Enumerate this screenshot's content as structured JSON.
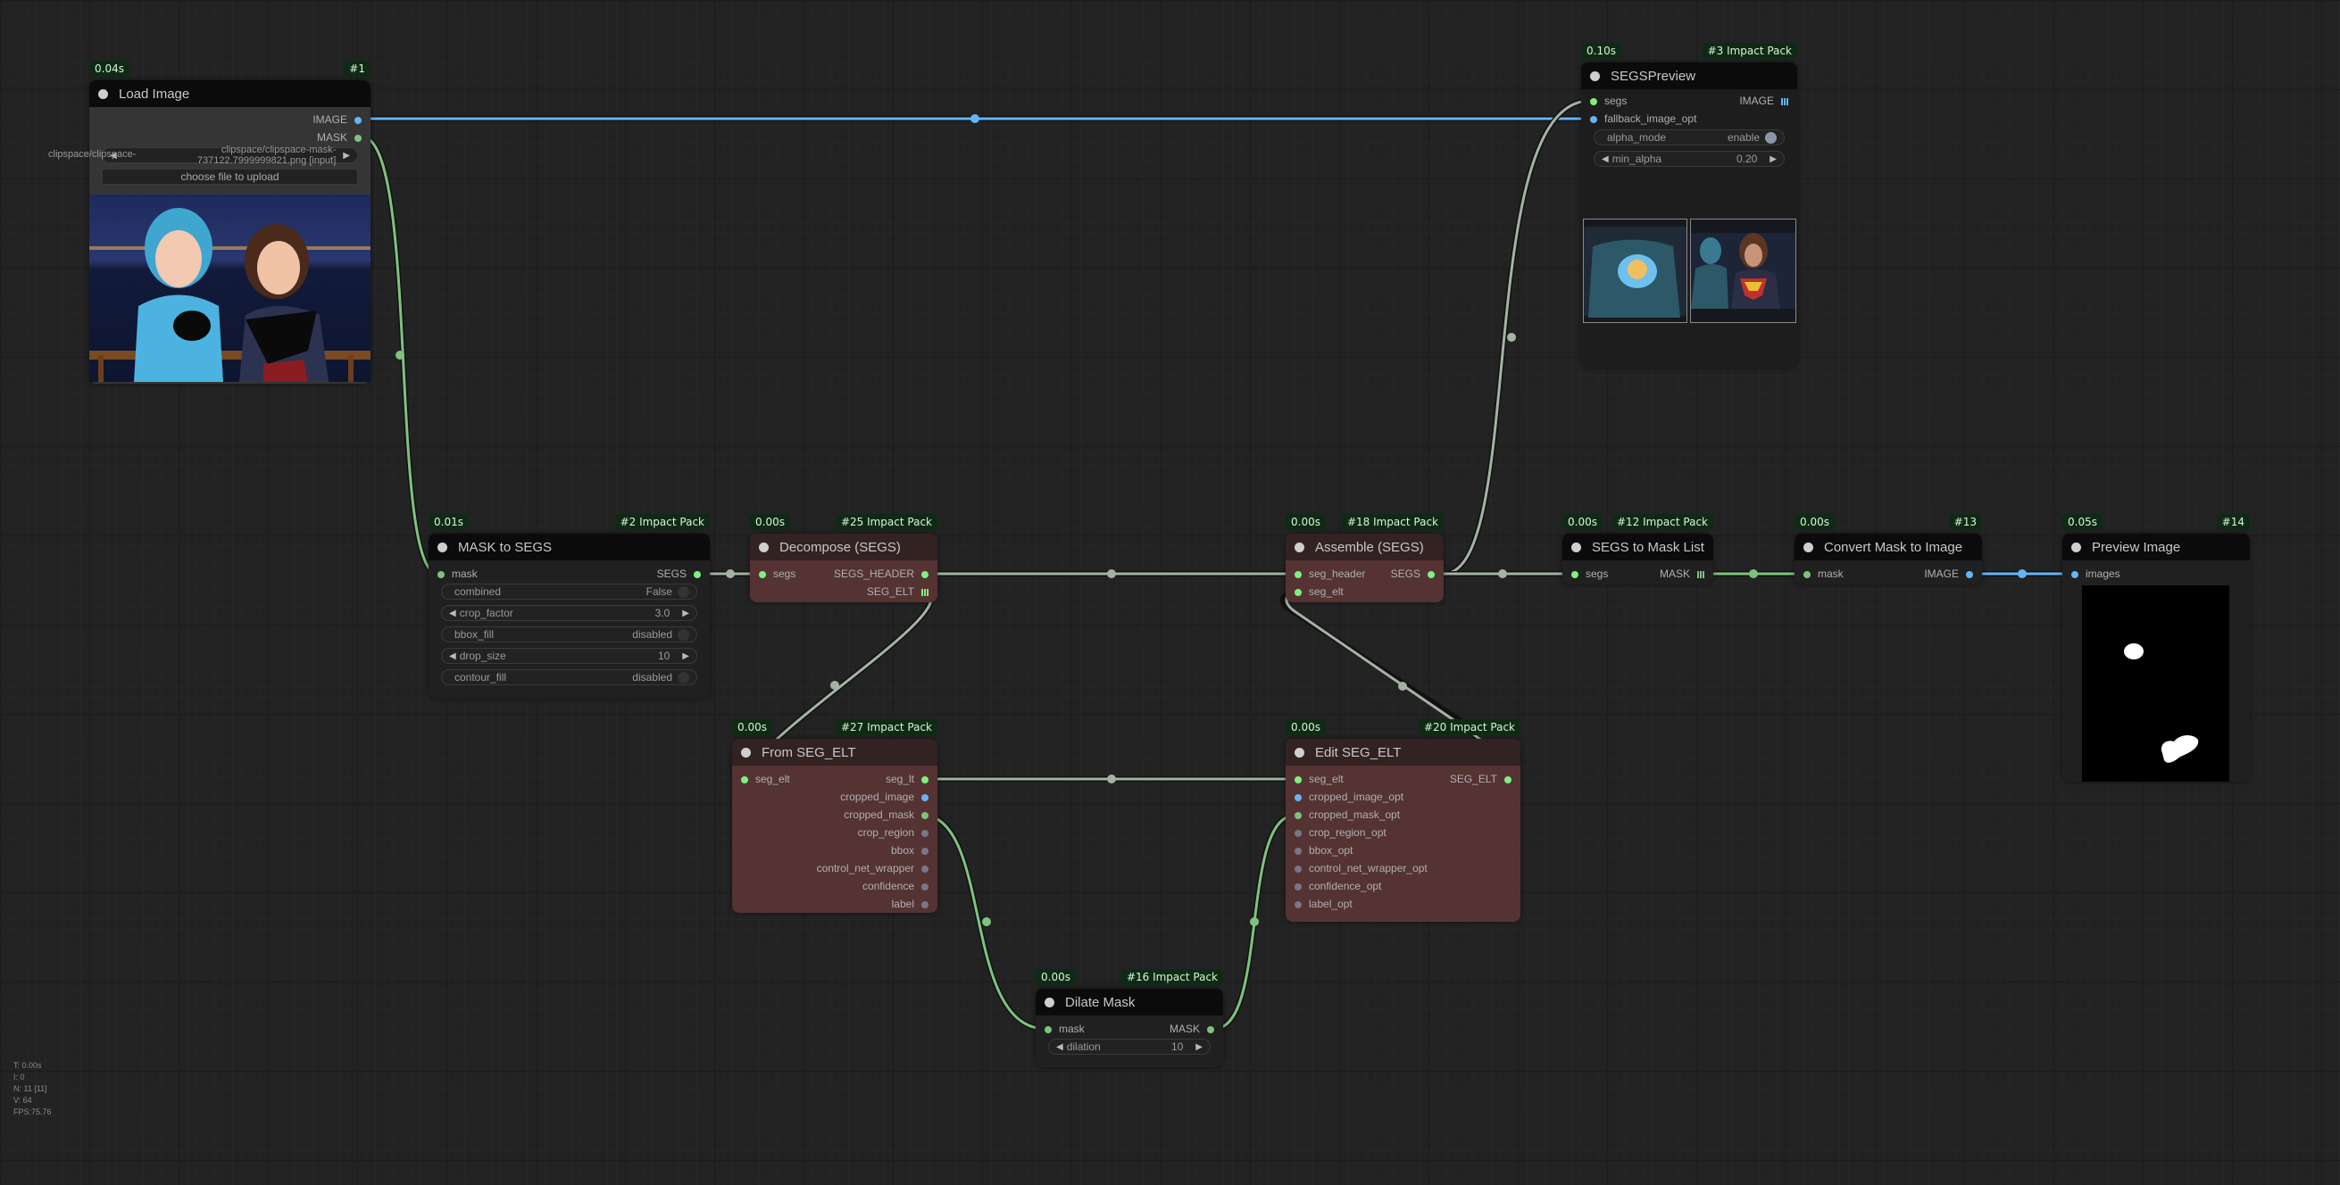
{
  "app": "ComfyUI",
  "stats": {
    "t": "T: 0.00s",
    "i": "I: 0",
    "n": "N: 11 [11]",
    "v": "V: 64",
    "fps": "FPS:75.76"
  },
  "colors": {
    "image_link": "#64b5f6",
    "mask_link": "#7ec27e",
    "segs_link": "#a3b3a3",
    "badge_bg": "#0f2a14"
  },
  "nodes": {
    "load_image": {
      "time": "0.04s",
      "id": "#1",
      "title": "Load Image",
      "outputs": [
        "IMAGE",
        "MASK"
      ],
      "image_widget": "clipspace/clipspace-mask-737122.7999999821.png [input]",
      "image_widget_overlay": "clipspace/clipspace-",
      "upload_button": "choose file to upload",
      "preview": "two women: blue-haired girl in blue t-shirt and brunette in superhero costume, masked regions"
    },
    "segs_preview": {
      "time": "0.10s",
      "id": "#3 Impact Pack",
      "title": "SEGSPreview",
      "inputs": [
        "segs",
        "fallback_image_opt"
      ],
      "outputs": [
        "IMAGE"
      ],
      "widgets": [
        {
          "label": "alpha_mode",
          "value": "enable",
          "type": "toggle",
          "on": true
        },
        {
          "label": "min_alpha",
          "value": "0.20",
          "type": "number"
        }
      ]
    },
    "mask_to_segs": {
      "time": "0.01s",
      "id": "#2 Impact Pack",
      "title": "MASK to SEGS",
      "inputs": [
        "mask"
      ],
      "outputs": [
        "SEGS"
      ],
      "widgets": [
        {
          "label": "combined",
          "value": "False",
          "type": "toggle",
          "on": false
        },
        {
          "label": "crop_factor",
          "value": "3.0",
          "type": "number"
        },
        {
          "label": "bbox_fill",
          "value": "disabled",
          "type": "toggle",
          "on": false
        },
        {
          "label": "drop_size",
          "value": "10",
          "type": "number"
        },
        {
          "label": "contour_fill",
          "value": "disabled",
          "type": "toggle",
          "on": false
        }
      ]
    },
    "decompose_segs": {
      "time": "0.00s",
      "id": "#25 Impact Pack",
      "title": "Decompose (SEGS)",
      "inputs": [
        "segs"
      ],
      "outputs": [
        "SEGS_HEADER",
        "SEG_ELT"
      ]
    },
    "assemble_segs": {
      "time": "0.00s",
      "id": "#18 Impact Pack",
      "title": "Assemble (SEGS)",
      "inputs": [
        "seg_header",
        "seg_elt"
      ],
      "outputs": [
        "SEGS"
      ]
    },
    "segs_to_mask_list": {
      "time": "0.00s",
      "id": "#12 Impact Pack",
      "title": "SEGS to Mask List",
      "inputs": [
        "segs"
      ],
      "outputs": [
        "MASK"
      ]
    },
    "convert_mask_to_image": {
      "time": "0.00s",
      "id": "#13",
      "title": "Convert Mask to Image",
      "inputs": [
        "mask"
      ],
      "outputs": [
        "IMAGE"
      ]
    },
    "preview_image": {
      "time": "0.05s",
      "id": "#14",
      "title": "Preview Image",
      "inputs": [
        "images"
      ]
    },
    "from_seg_elt": {
      "time": "0.00s",
      "id": "#27 Impact Pack",
      "title": "From SEG_ELT",
      "inputs": [
        "seg_elt"
      ],
      "outputs": [
        "seg_lt",
        "cropped_image",
        "cropped_mask",
        "crop_region",
        "bbox",
        "control_net_wrapper",
        "confidence",
        "label"
      ]
    },
    "edit_seg_elt": {
      "time": "0.00s",
      "id": "#20 Impact Pack",
      "title": "Edit SEG_ELT",
      "inputs": [
        "seg_elt",
        "cropped_image_opt",
        "cropped_mask_opt",
        "crop_region_opt",
        "bbox_opt",
        "control_net_wrapper_opt",
        "confidence_opt",
        "label_opt"
      ],
      "outputs": [
        "SEG_ELT"
      ]
    },
    "dilate_mask": {
      "time": "0.00s",
      "id": "#16 Impact Pack",
      "title": "Dilate Mask",
      "inputs": [
        "mask"
      ],
      "outputs": [
        "MASK"
      ],
      "widgets": [
        {
          "label": "dilation",
          "value": "10",
          "type": "number"
        }
      ]
    }
  }
}
